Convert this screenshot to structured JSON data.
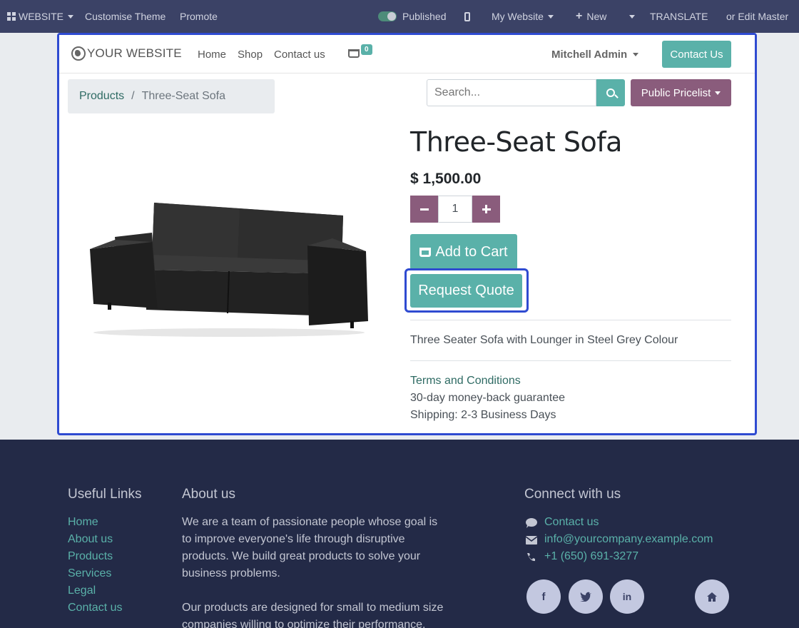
{
  "adminbar": {
    "website_label": "WEBSITE",
    "customise_label": "Customise Theme",
    "promote_label": "Promote",
    "published_label": "Published",
    "my_website_label": "My Website",
    "new_label": "New",
    "translate_label": "TRANSLATE",
    "edit_master_label": "or Edit Master"
  },
  "header": {
    "logo_text": "YOUR WEBSITE",
    "nav": [
      "Home",
      "Shop",
      "Contact us"
    ],
    "cart_count": "0",
    "user_name": "Mitchell Admin",
    "contact_button": "Contact Us"
  },
  "breadcrumb": {
    "parent": "Products",
    "separator": "/",
    "current": "Three-Seat Sofa"
  },
  "search": {
    "placeholder": "Search..."
  },
  "pricelist": {
    "label": "Public Pricelist"
  },
  "product": {
    "name": "Three-Seat Sofa",
    "price": "$ 1,500.00",
    "quantity": "1",
    "add_to_cart": "Add to Cart",
    "request_quote": "Request Quote",
    "description": "Three Seater Sofa with Lounger in Steel Grey Colour",
    "terms_link": "Terms and Conditions",
    "guarantee": "30-day money-back guarantee",
    "shipping": "Shipping: 2-3 Business Days"
  },
  "footer": {
    "useful_links_title": "Useful Links",
    "useful_links": [
      "Home",
      "About us",
      "Products",
      "Services",
      "Legal",
      "Contact us"
    ],
    "about_title": "About us",
    "about_lines": [
      "We are a team of passionate people whose goal is",
      "to improve everyone's life through disruptive",
      "products. We build great products to solve your",
      "business problems."
    ],
    "about_lines2": [
      "Our products are designed for small to medium size",
      "companies willing to optimize their performance."
    ],
    "connect_title": "Connect with us",
    "contact_link": "Contact us",
    "email": "info@yourcompany.example.com",
    "phone": "+1 (650) 691-3277",
    "social": [
      "facebook-icon",
      "twitter-icon",
      "linkedin-icon",
      "home-icon"
    ]
  },
  "colors": {
    "accent": "#5ab1a9",
    "secondary": "#8a5c7c",
    "adminbar": "#3b4266",
    "footer": "#232a47",
    "focus": "#2f4bd1"
  }
}
